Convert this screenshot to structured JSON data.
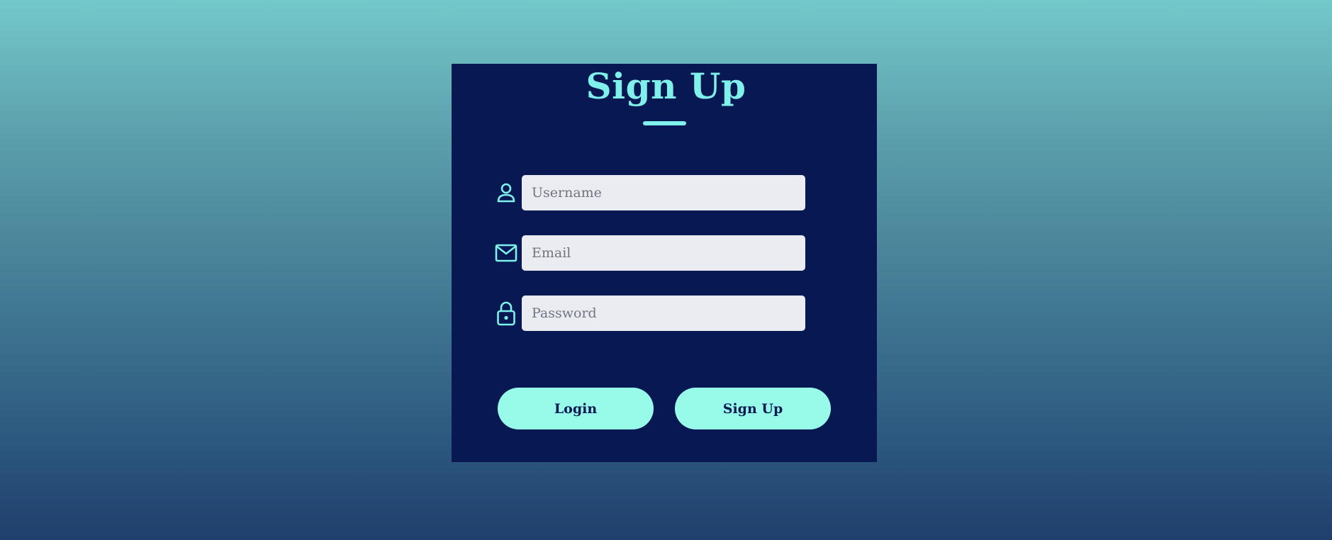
{
  "form": {
    "title": "Sign Up",
    "fields": [
      {
        "name": "username",
        "placeholder": "Username",
        "icon": "person-icon",
        "value": ""
      },
      {
        "name": "email",
        "placeholder": "Email",
        "icon": "envelope-icon",
        "value": ""
      },
      {
        "name": "password",
        "placeholder": "Password",
        "icon": "lock-icon",
        "value": ""
      }
    ],
    "buttons": {
      "login_label": "Login",
      "signup_label": "Sign Up"
    }
  },
  "colors": {
    "background_top": "#73c9ca",
    "background_bottom": "#203f6c",
    "card": "#071853",
    "accent": "#7ff0ea",
    "button": "#98fbe9",
    "input": "#ebecf1"
  }
}
